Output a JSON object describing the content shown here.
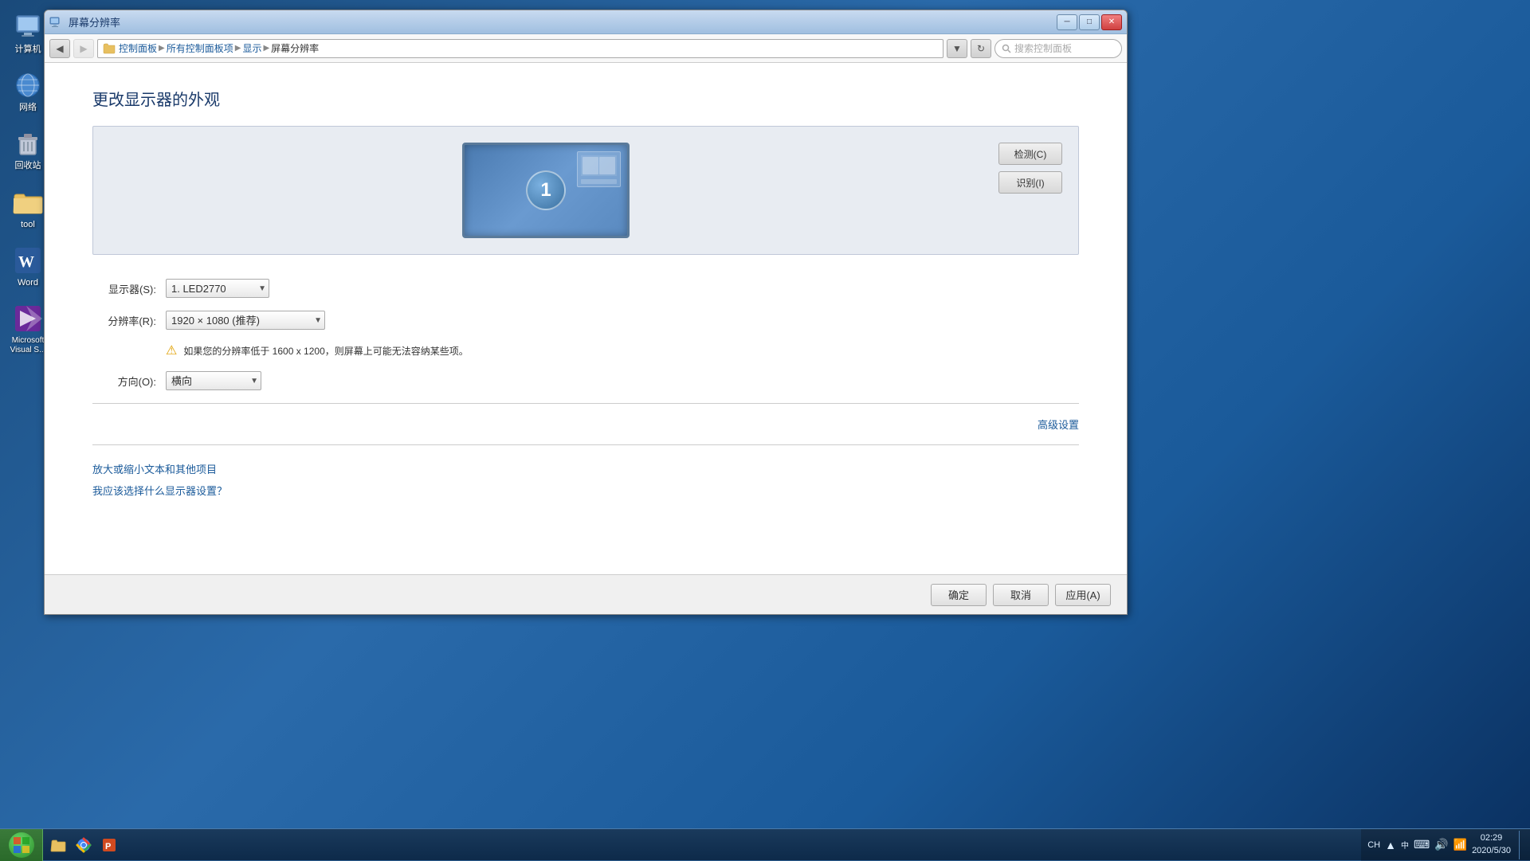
{
  "window": {
    "title": "屏幕分辨率",
    "controls": {
      "minimize": "─",
      "maximize": "□",
      "close": "✕"
    }
  },
  "addressbar": {
    "back_tooltip": "后退",
    "forward_tooltip": "前进",
    "breadcrumb": [
      "控制面板",
      "所有控制面板项",
      "显示",
      "屏幕分辨率"
    ],
    "search_placeholder": "搜索控制面板"
  },
  "page": {
    "title": "更改显示器的外观",
    "monitor_number": "1",
    "buttons": {
      "detect": "检测(C)",
      "identify": "识别(I)"
    },
    "fields": {
      "display_label": "显示器(S):",
      "display_value": "1. LED2770",
      "resolution_label": "分辨率(R):",
      "resolution_value": "1920 × 1080 (推荐)",
      "orientation_label": "方向(O):",
      "orientation_value": "横向"
    },
    "warning": "如果您的分辨率低于 1600 x 1200，则屏幕上可能无法容纳某些项。",
    "advanced_link": "高级设置",
    "help_links": [
      "放大或缩小文本和其他项目",
      "我应该选择什么显示器设置？"
    ]
  },
  "footer": {
    "ok_label": "确定",
    "cancel_label": "取消",
    "apply_label": "应用(A)"
  },
  "taskbar": {
    "start_label": "开始",
    "items": [],
    "clock": "2020/5/30",
    "clock_time": ""
  },
  "desktop_icons": [
    {
      "label": "计算机",
      "icon": "💻"
    },
    {
      "label": "网络",
      "icon": "🌐"
    },
    {
      "label": "回收站",
      "icon": "🗑️"
    },
    {
      "label": "tool",
      "icon": "📁"
    },
    {
      "label": "Word",
      "icon": "W"
    },
    {
      "label": "Microsoft Visual S...",
      "icon": "🔷"
    }
  ],
  "colors": {
    "accent_blue": "#1a5a9a",
    "link_blue": "#1a5a9a",
    "warning_yellow": "#e0a000"
  }
}
